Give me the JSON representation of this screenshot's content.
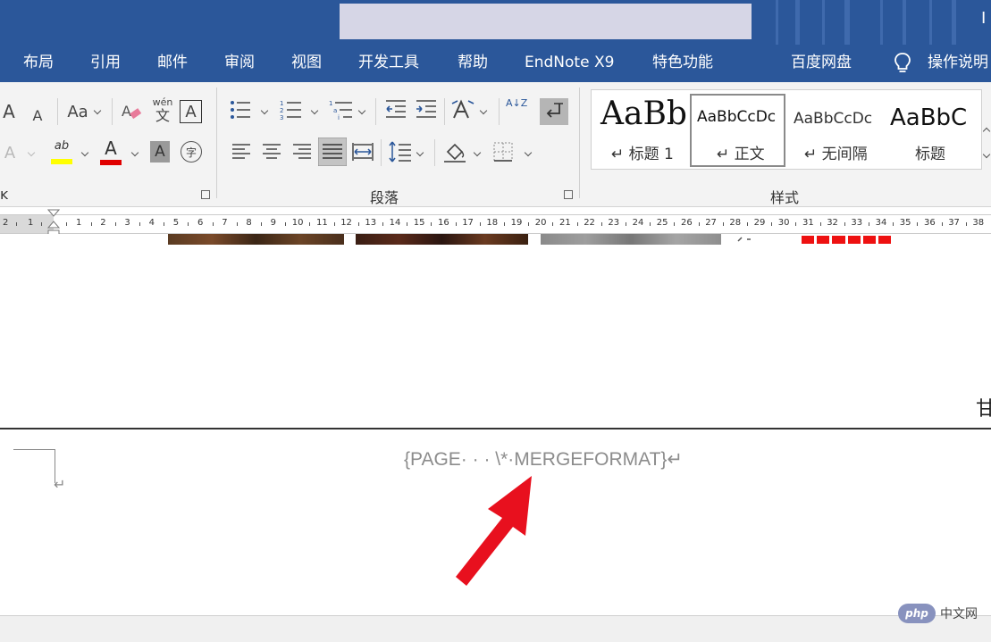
{
  "titlebar": {
    "partial_right_char": "I"
  },
  "tabs": [
    {
      "id": "layout",
      "label": "布局"
    },
    {
      "id": "references",
      "label": "引用"
    },
    {
      "id": "mailings",
      "label": "邮件"
    },
    {
      "id": "review",
      "label": "审阅"
    },
    {
      "id": "view",
      "label": "视图"
    },
    {
      "id": "developer",
      "label": "开发工具"
    },
    {
      "id": "help",
      "label": "帮助"
    },
    {
      "id": "endnote",
      "label": "EndNote X9"
    },
    {
      "id": "features",
      "label": "特色功能"
    },
    {
      "id": "baidu",
      "label": "百度网盘"
    }
  ],
  "tell_me": {
    "label": "操作说明"
  },
  "ribbon": {
    "font_group": {
      "grow_font_glyph": "A",
      "shrink_font_glyph": "A",
      "change_case_glyph": "Aa",
      "phonetic_top": "wén",
      "phonetic_bottom": "文",
      "char_border_glyph": "A",
      "text_effects_glyph": "A",
      "highlight_glyph": "ab",
      "font_color_glyph": "A",
      "char_shading_glyph": "A",
      "enclose_char_glyph": "字",
      "highlight_color": "#ffff00",
      "font_color": "#e00000",
      "label": "ĸ"
    },
    "paragraph_group": {
      "label": "段落",
      "sort_glyph": "A↓Z"
    },
    "styles_group": {
      "label": "样式",
      "items": [
        {
          "id": "heading1",
          "sample": "AaBb",
          "name": "↵ 标题 1"
        },
        {
          "id": "body",
          "sample": "AaBbCcDc",
          "name": "↵ 正文"
        },
        {
          "id": "no-spacing",
          "sample": "AaBbCcDc",
          "name": "↵ 无间隔"
        },
        {
          "id": "title",
          "sample": "AaBbC",
          "name": "标题"
        }
      ]
    }
  },
  "ruler": {
    "left_numbers": [
      "2",
      "1"
    ],
    "numbers": [
      "1",
      "2",
      "3",
      "4",
      "5",
      "6",
      "7",
      "8",
      "9",
      "10",
      "11",
      "12",
      "13",
      "14",
      "15",
      "16",
      "17",
      "18",
      "19",
      "20",
      "21",
      "22",
      "23",
      "24",
      "25",
      "26",
      "27",
      "28",
      "29",
      "30",
      "31",
      "32",
      "33",
      "34",
      "35",
      "36",
      "37",
      "38"
    ]
  },
  "document": {
    "field_code": "{PAGE· · · \\*·MERGEFORMAT}↵",
    "para_mark": "↵",
    "edge_char": "甘"
  },
  "annotation": {
    "color": "#e8101e"
  },
  "watermark": {
    "logo": "php",
    "text": "中文网"
  }
}
